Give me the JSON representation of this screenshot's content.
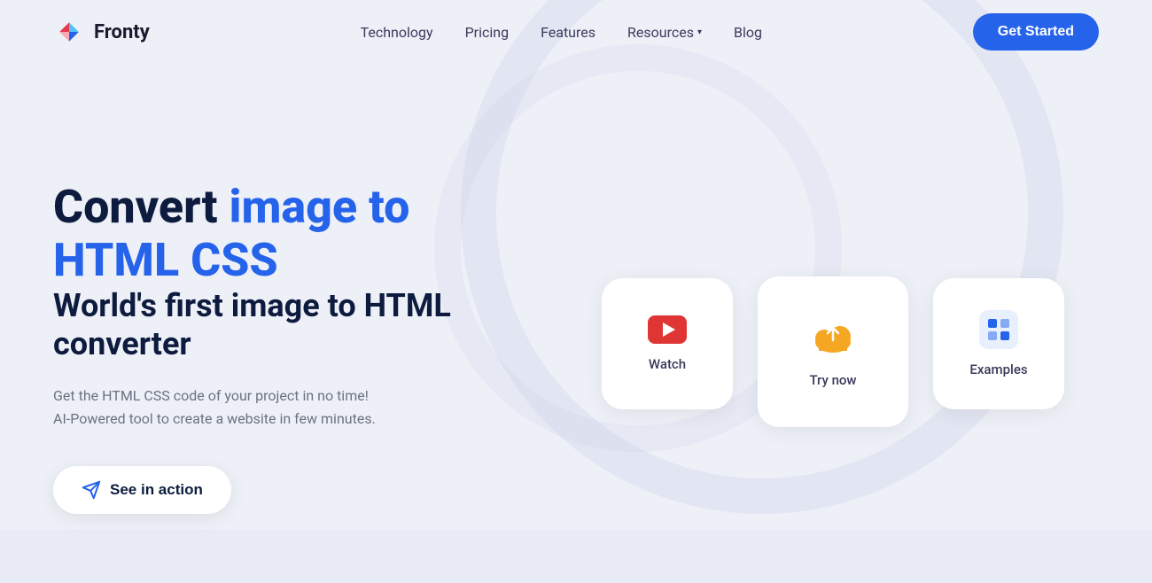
{
  "brand": {
    "name": "Fronty"
  },
  "nav": {
    "links": [
      {
        "id": "technology",
        "label": "Technology"
      },
      {
        "id": "pricing",
        "label": "Pricing"
      },
      {
        "id": "features",
        "label": "Features"
      },
      {
        "id": "resources",
        "label": "Resources"
      },
      {
        "id": "blog",
        "label": "Blog"
      }
    ],
    "cta_label": "Get Started"
  },
  "hero": {
    "title_static": "Convert ",
    "title_highlight": "image to HTML CSS",
    "subtitle": "World's first image to HTML converter",
    "description_line1": "Get the HTML CSS code of your project in no time!",
    "description_line2": "AI-Powered tool to create a website in few minutes.",
    "cta_label": "See in action"
  },
  "cards": [
    {
      "id": "watch",
      "label": "Watch",
      "icon": "youtube"
    },
    {
      "id": "try-now",
      "label": "Try now",
      "icon": "cloud-upload"
    },
    {
      "id": "examples",
      "label": "Examples",
      "icon": "gallery"
    }
  ],
  "colors": {
    "brand_blue": "#2563eb",
    "text_dark": "#0d1b3e",
    "text_muted": "#6b7280"
  }
}
